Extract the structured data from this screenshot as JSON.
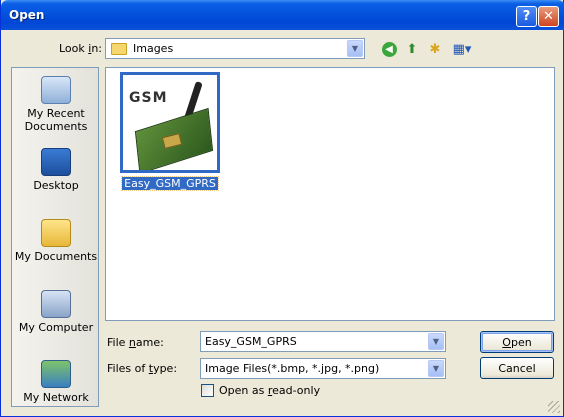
{
  "window": {
    "title": "Open",
    "help_glyph": "?",
    "close_glyph": "✕"
  },
  "lookin": {
    "label": "Look in:",
    "label_accel": "i",
    "value": "Images"
  },
  "toolbar": {
    "back_icon": "back-arrow-icon",
    "up_icon": "up-folder-icon",
    "newfolder_icon": "new-folder-icon",
    "views_icon": "views-menu-icon"
  },
  "places": [
    {
      "label": "My Recent Documents",
      "icon": "recent-documents-icon"
    },
    {
      "label": "Desktop",
      "icon": "desktop-icon"
    },
    {
      "label": "My Documents",
      "icon": "my-documents-icon"
    },
    {
      "label": "My Computer",
      "icon": "my-computer-icon"
    },
    {
      "label": "My Network",
      "icon": "my-network-icon"
    }
  ],
  "files": [
    {
      "name": "Easy_GSM_GPRS",
      "thumb_text": "GSM",
      "selected": true
    }
  ],
  "filename": {
    "label_pre": "File ",
    "label_accel": "n",
    "label_post": "ame:",
    "value": "Easy_GSM_GPRS"
  },
  "filetype": {
    "label_pre": "Files of ",
    "label_accel": "t",
    "label_post": "ype:",
    "value": "Image Files(*.bmp, *.jpg, *.png)"
  },
  "readonly": {
    "label_pre": "Open as ",
    "label_accel": "r",
    "label_post": "ead-only",
    "checked": false
  },
  "buttons": {
    "open_accel": "O",
    "open_rest": "pen",
    "cancel": "Cancel"
  },
  "colors": {
    "titlebar": "#0453df",
    "selection": "#316ac5",
    "dialog_bg": "#ece9d8"
  }
}
